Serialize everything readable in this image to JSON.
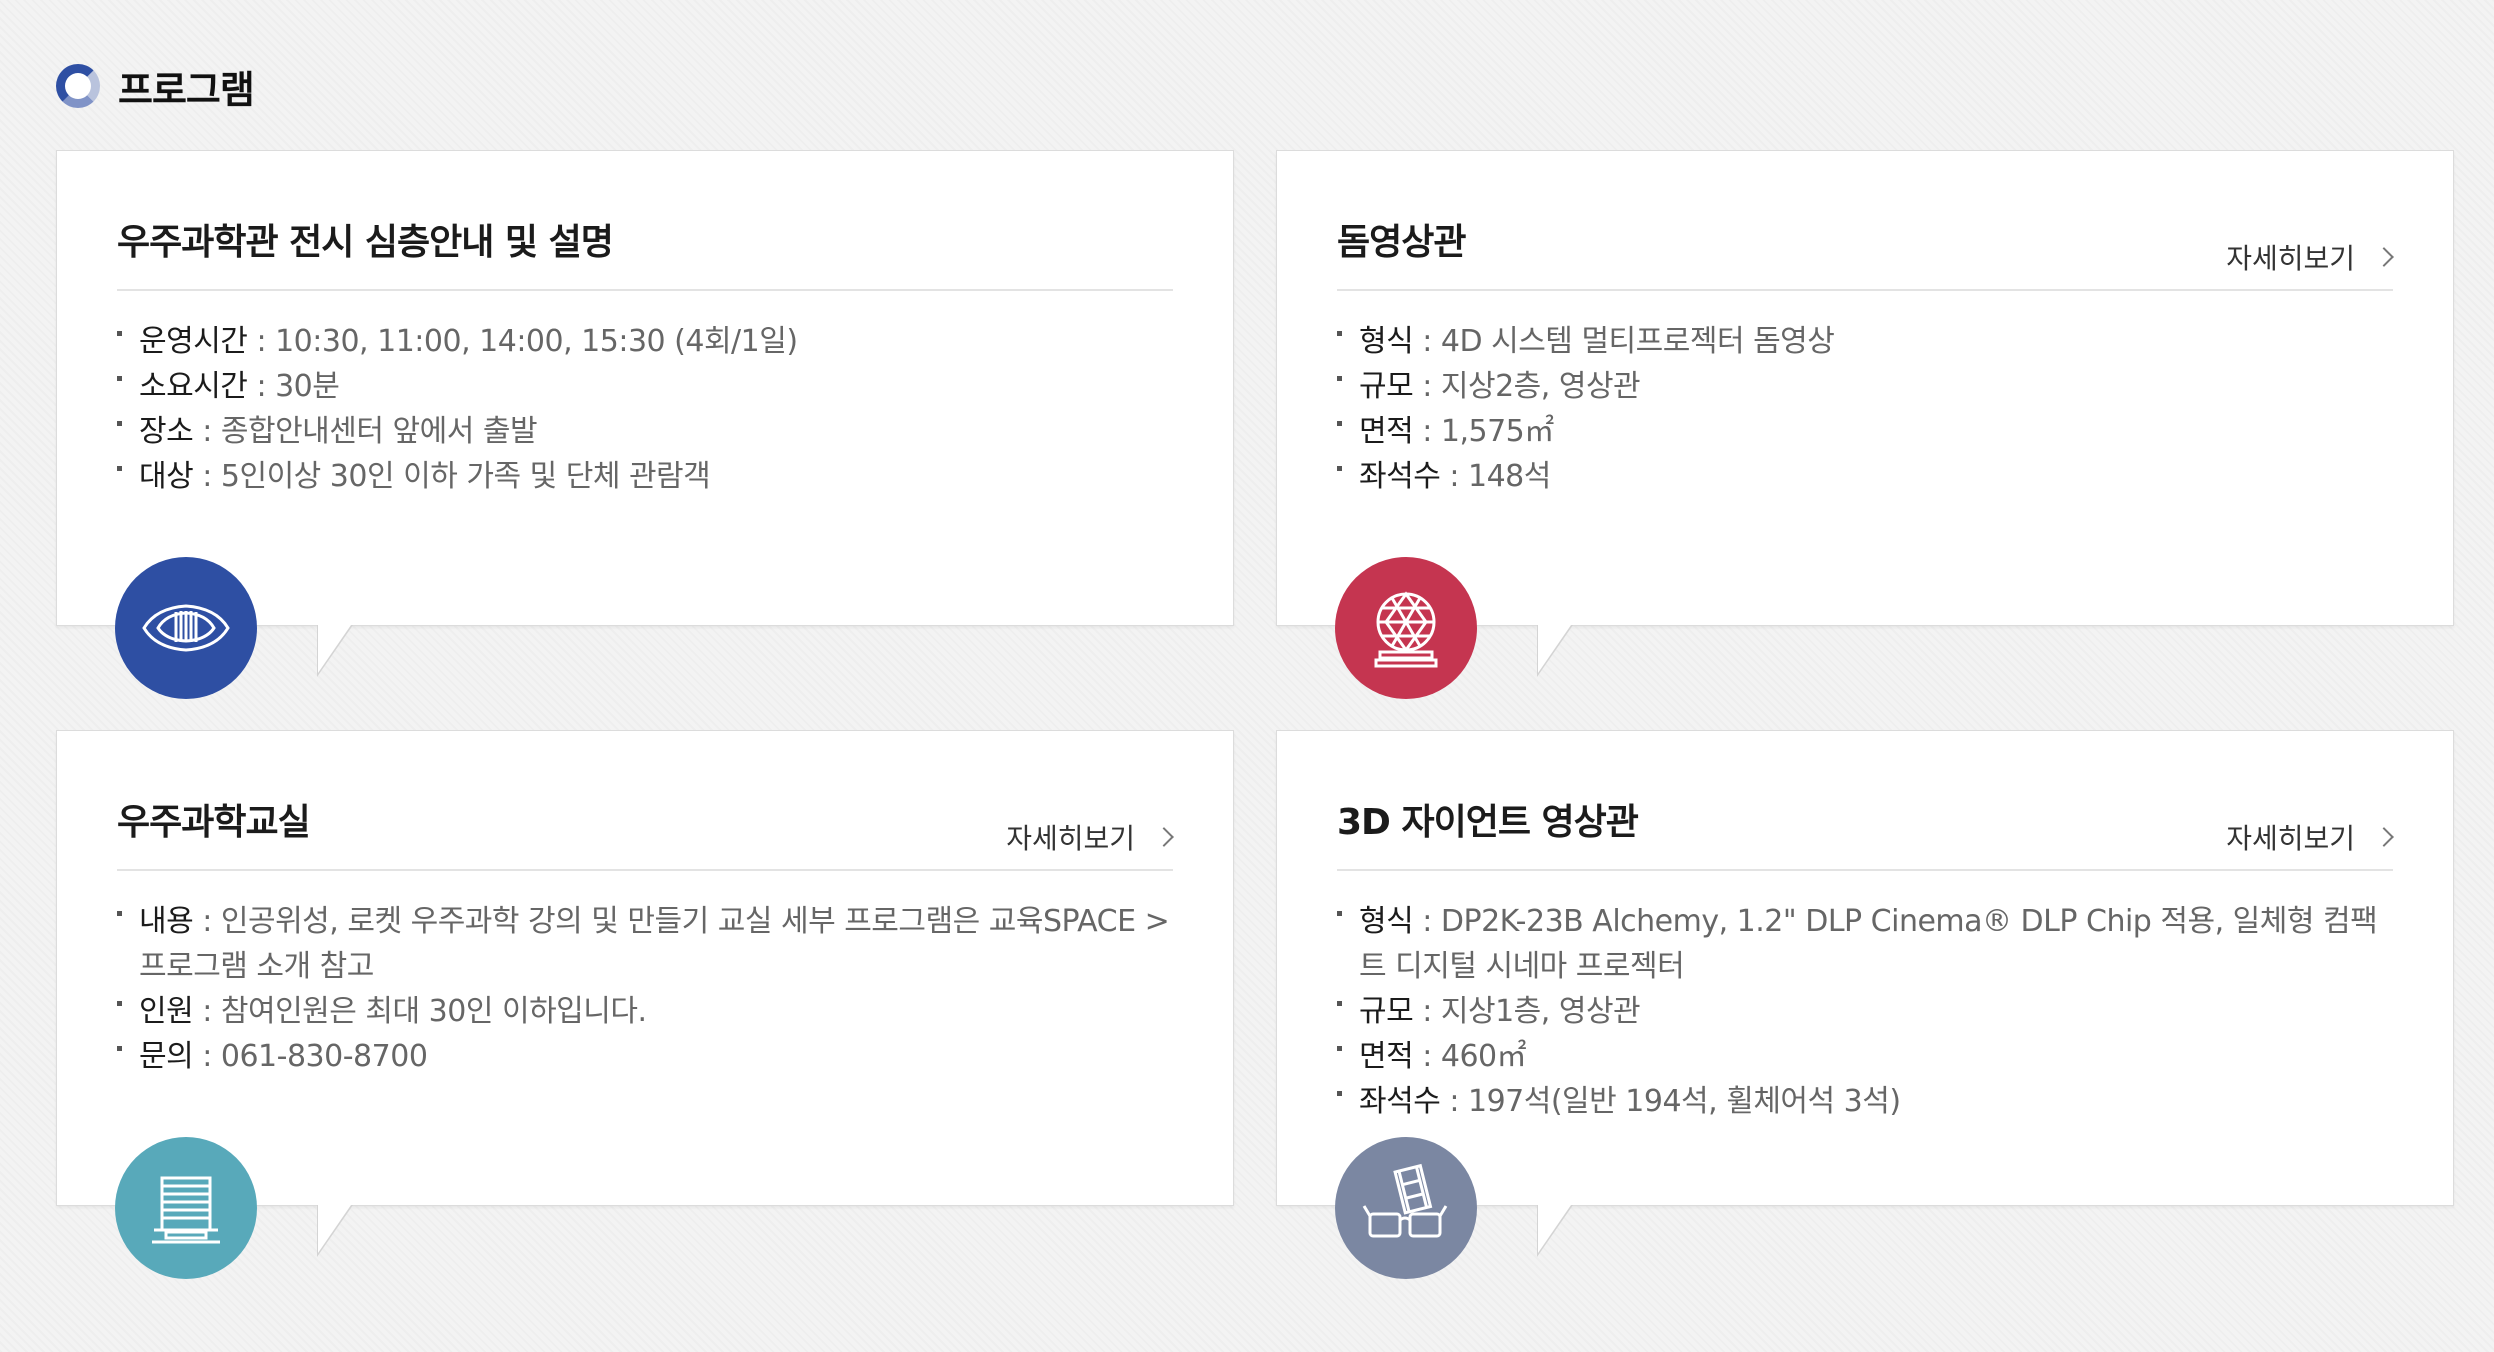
{
  "section": {
    "title": "프로그램"
  },
  "colors": {
    "blue": "#2e4fa3",
    "red": "#c53550",
    "teal": "#58a9ba",
    "slate": "#7b87a2"
  },
  "cards": [
    {
      "title": "우주과학관 전시 심층안내 및 설명",
      "more": "",
      "icon": "observatory-arch-icon",
      "items": [
        {
          "key": "운영시간",
          "value": " : 10:30, 11:00, 14:00, 15:30 (4회/1일)"
        },
        {
          "key": "소요시간",
          "value": " : 30분"
        },
        {
          "key": "장소",
          "value": " : 종합안내센터 앞에서 출발"
        },
        {
          "key": "대상",
          "value": " : 5인이상 30인 이하 가족 및 단체 관람객"
        }
      ]
    },
    {
      "title": "돔영상관",
      "more": "자세히보기",
      "icon": "geodesic-dome-icon",
      "items": [
        {
          "key": "형식",
          "value": " : 4D 시스템 멀티프로젝터 돔영상"
        },
        {
          "key": "규모",
          "value": " : 지상2층, 영상관"
        },
        {
          "key": "면적",
          "value": " : 1,575㎡"
        },
        {
          "key": "좌석수",
          "value": " : 148석"
        }
      ]
    },
    {
      "title": "우주과학교실",
      "more": "자세히보기",
      "icon": "classroom-building-icon",
      "items": [
        {
          "key": "내용",
          "value": " : 인공위성, 로켓 우주과학 강의 및 만들기 교실 세부 프로그램은 교육SPACE > 프로그램 소개 참고"
        },
        {
          "key": "인원",
          "value": " : 참여인원은 최대 30인 이하입니다."
        },
        {
          "key": "문의",
          "value": " : 061-830-8700"
        }
      ]
    },
    {
      "title": "3D 자이언트 영상관",
      "more": "자세히보기",
      "icon": "3d-glasses-film-icon",
      "items": [
        {
          "key": "형식",
          "value": " : DP2K-23B Alchemy, 1.2\" DLP Cinema® DLP Chip 적용, 일체형 컴팩트 디지털 시네마 프로젝터"
        },
        {
          "key": "규모",
          "value": " : 지상1층, 영상관"
        },
        {
          "key": "면적",
          "value": " : 460㎡"
        },
        {
          "key": "좌석수",
          "value": " : 197석(일반 194석, 휠체어석 3석)"
        }
      ]
    }
  ]
}
